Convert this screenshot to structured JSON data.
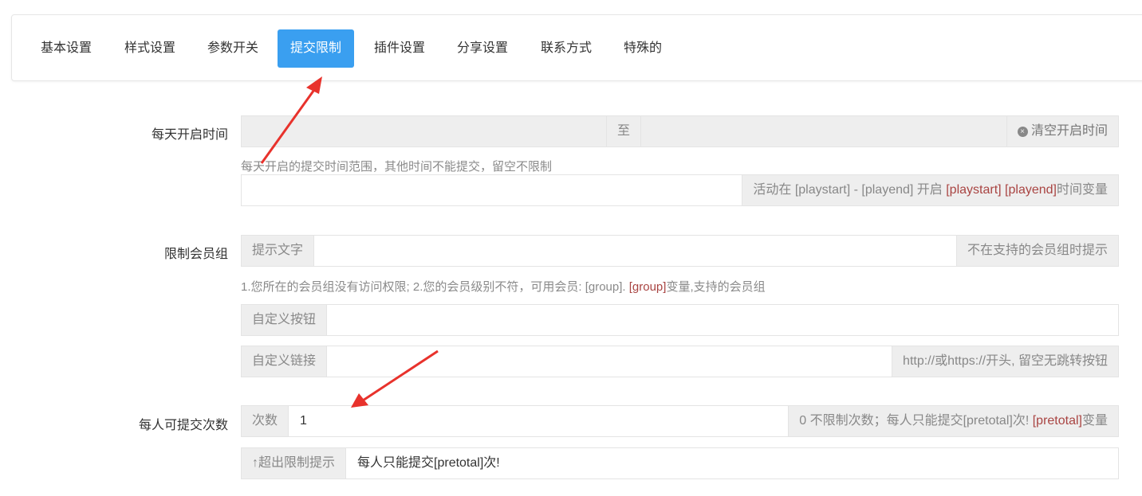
{
  "tabs": [
    {
      "label": "基本设置",
      "active": false
    },
    {
      "label": "样式设置",
      "active": false
    },
    {
      "label": "参数开关",
      "active": false
    },
    {
      "label": "提交限制",
      "active": true
    },
    {
      "label": "插件设置",
      "active": false
    },
    {
      "label": "分享设置",
      "active": false
    },
    {
      "label": "联系方式",
      "active": false
    },
    {
      "label": "特殊的",
      "active": false
    }
  ],
  "tab_right": {
    "icon": "trash-icon",
    "text": "🗑"
  },
  "daily_time": {
    "label": "每天开启时间",
    "separator": "至",
    "clear_label": "清空开启时间",
    "clear_icon": "close-circle-icon",
    "help": "每天开启的提交时间范围，其他时间不能提交，留空不限制",
    "msg_addon_prefix": "活动在 [playstart] - [playend] 开启 ",
    "msg_addon_var1": "[playstart]",
    "msg_addon_var2": "[playend]",
    "msg_addon_suffix": "时间变量"
  },
  "member_group": {
    "label": "限制会员组",
    "prompt_addon": "提示文字",
    "prompt_right": "不在支持的会员组时提示",
    "help_prefix": "1.您所在的会员组没有访问权限; 2.您的会员级别不符，可用会员: [group]. ",
    "help_var": "[group]",
    "help_suffix": "变量,支持的会员组",
    "custom_button_addon": "自定义按钮",
    "custom_link_addon": "自定义链接",
    "custom_link_right": "http://或https://开头, 留空无跳转按钮"
  },
  "submit_count": {
    "label": "每人可提交次数",
    "count_addon": "次数",
    "count_value": "1",
    "count_right_prefix": "0 不限制次数；每人只能提交[pretotal]次!  ",
    "count_right_var": "[pretotal]",
    "count_right_suffix": "变量",
    "exceed_addon": "↑超出限制提示",
    "exceed_value": "每人只能提交[pretotal]次!"
  },
  "colors": {
    "accent": "#3a9ff0",
    "variable": "#a94442",
    "arrow": "#e8322c"
  }
}
